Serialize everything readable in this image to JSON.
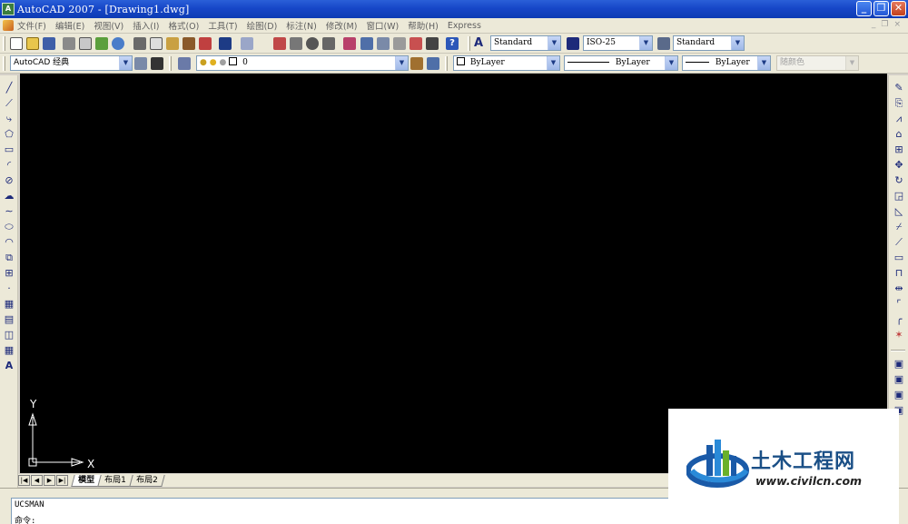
{
  "window": {
    "title": "AutoCAD 2007 - [Drawing1.dwg]",
    "app_icon": "autocad-logo-icon",
    "controls": [
      "minimize",
      "restore",
      "close"
    ]
  },
  "menubar": {
    "items": [
      "文件(F)",
      "编辑(E)",
      "视图(V)",
      "插入(I)",
      "格式(O)",
      "工具(T)",
      "绘图(D)",
      "标注(N)",
      "修改(M)",
      "窗口(W)",
      "帮助(H)",
      "Express"
    ]
  },
  "toolbar_standard": {
    "text_style": "Standard",
    "dim_style": "ISO-25",
    "table_style": "Standard"
  },
  "toolbar_layers": {
    "workspace": "AutoCAD 经典",
    "layer": "0",
    "color": "ByLayer",
    "linetype": "ByLayer",
    "lineweight": "ByLayer",
    "plot_style": "随颜色"
  },
  "canvas": {
    "background": "#000000",
    "ucs_x_label": "X",
    "ucs_y_label": "Y"
  },
  "tabs": {
    "items": [
      "模型",
      "布局1",
      "布局2"
    ],
    "active": "模型"
  },
  "command": {
    "history": "UCSMAN",
    "prompt": "命令:"
  },
  "watermark": {
    "title": "土木工程网",
    "url": "www.civilcn.com"
  }
}
